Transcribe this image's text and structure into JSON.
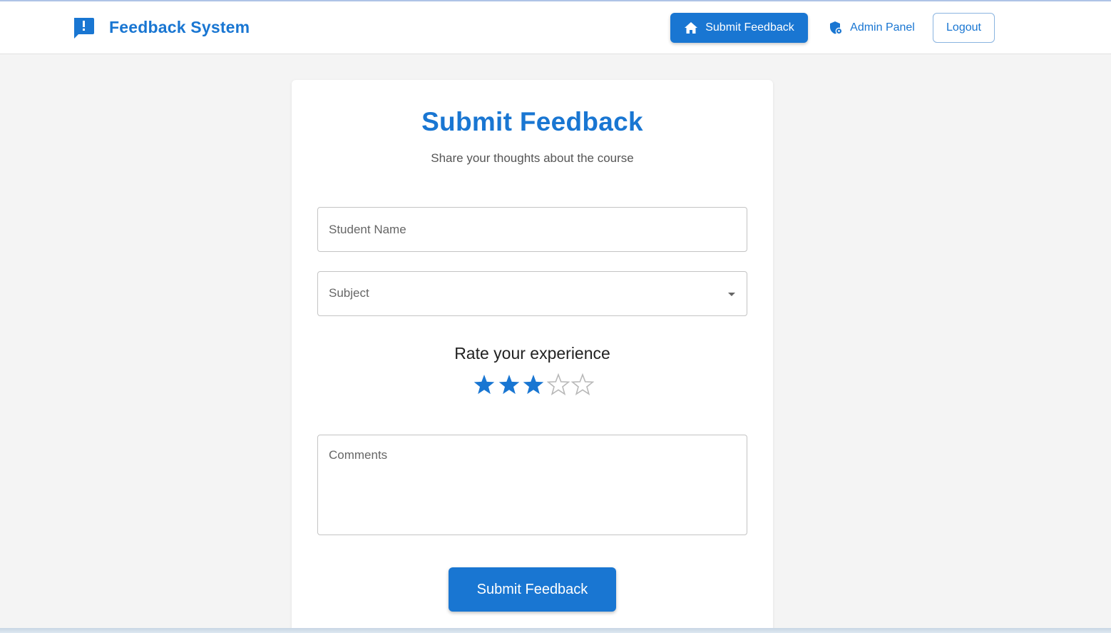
{
  "navbar": {
    "brand_icon": "feedback-icon",
    "brand_title": "Feedback System",
    "submit_label": "Submit Feedback",
    "submit_icon": "home-icon",
    "admin_label": "Admin Panel",
    "admin_icon": "admin-shield-icon",
    "logout_label": "Logout"
  },
  "form": {
    "title": "Submit Feedback",
    "subtitle": "Share your thoughts about the course",
    "student_name": {
      "value": "",
      "placeholder": "Student Name"
    },
    "subject": {
      "value": "",
      "label": "Subject",
      "icon": "chevron-down-icon"
    },
    "rating_label": "Rate your experience",
    "rating": {
      "value": 3,
      "max": 5
    },
    "comments": {
      "value": "",
      "placeholder": "Comments"
    },
    "submit_label": "Submit Feedback"
  },
  "colors": {
    "primary": "#1976d2",
    "background": "#f4f4f4",
    "star_empty": "#b8b8b8"
  }
}
